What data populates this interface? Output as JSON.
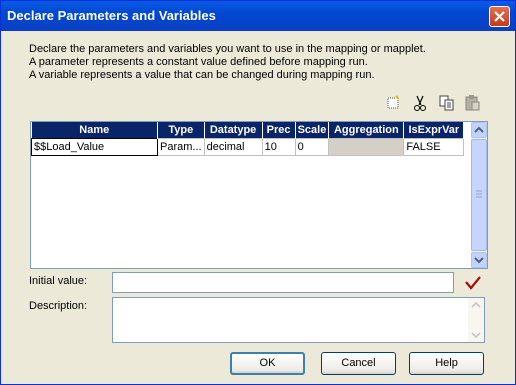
{
  "window": {
    "title": "Declare Parameters and Variables"
  },
  "description": {
    "line1": "Declare the parameters and variables you want to use in the mapping or mapplet.",
    "line2": "A parameter represents a constant value defined before mapping run.",
    "line3": "A variable represents a value that can be changed during mapping run."
  },
  "toolbar": {
    "icons": [
      "new-icon",
      "cut-icon",
      "copy-icon",
      "paste-icon"
    ]
  },
  "grid": {
    "headers": {
      "name": "Name",
      "type": "Type",
      "datatype": "Datatype",
      "prec": "Prec",
      "scale": "Scale",
      "aggregation": "Aggregation",
      "isexprvar": "IsExprVar"
    },
    "rows": [
      {
        "name": "$$Load_Value",
        "type": "Param...",
        "datatype": "decimal",
        "prec": "10",
        "scale": "0",
        "aggregation": "",
        "isexprvar": "FALSE"
      }
    ]
  },
  "initial_value": {
    "label": "Initial value:",
    "value": ""
  },
  "description_field": {
    "label": "Description:",
    "value": ""
  },
  "buttons": {
    "ok": "OK",
    "cancel": "Cancel",
    "help": "Help"
  },
  "colors": {
    "titlebar": "#0a5ae6",
    "grid_header": "#0a246a",
    "checkmark": "#a01010"
  }
}
